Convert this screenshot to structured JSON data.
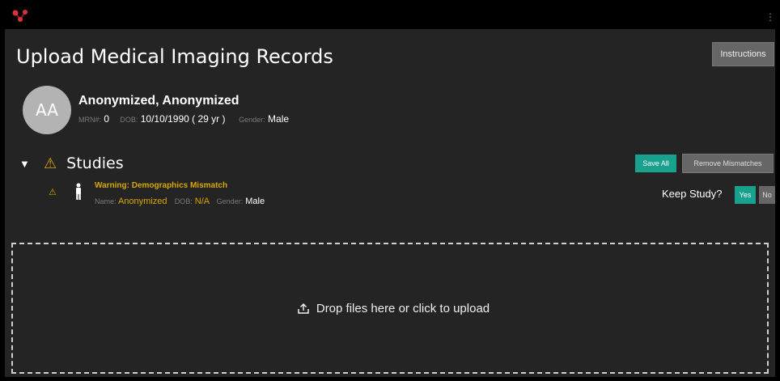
{
  "topbar": {
    "menu_glyph": "⋮"
  },
  "page": {
    "title": "Upload Medical Imaging Records",
    "instructions_label": "Instructions"
  },
  "patient": {
    "initials": "AA",
    "name": "Anonymized, Anonymized",
    "mrn_label": "MRN#:",
    "mrn_value": "0",
    "dob_label": "DOB:",
    "dob_value": "10/10/1990 ( 29 yr )",
    "gender_label": "Gender:",
    "gender_value": "Male"
  },
  "studies": {
    "title": "Studies",
    "save_all_label": "Save All",
    "remove_mismatches_label": "Remove Mismatches",
    "items": [
      {
        "warning": "Warning: Demographics Mismatch",
        "name_label": "Name:",
        "name_value": "Anonymized",
        "dob_label": "DOB:",
        "dob_value": "N/A",
        "gender_label": "Gender:",
        "gender_value": "Male",
        "keep_label": "Keep Study?",
        "yes_label": "Yes",
        "no_label": "No"
      }
    ]
  },
  "dropzone": {
    "text": "Drop files here or click to upload"
  },
  "icons": {
    "logo": "logo-icon",
    "caret": "caret-down-icon",
    "warning": "warning-icon",
    "person": "person-icon",
    "upload": "upload-icon"
  },
  "colors": {
    "accent": "#18a18c",
    "warning": "#d8a800",
    "panel": "#242424",
    "button_gray": "#666666"
  }
}
